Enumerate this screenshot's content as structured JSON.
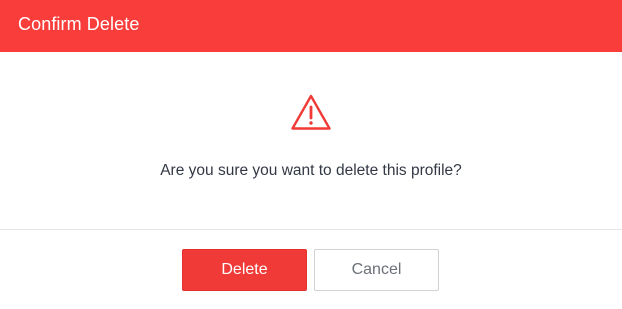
{
  "dialog": {
    "title": "Confirm Delete",
    "icon": "warning-triangle-icon",
    "message": "Are you sure you want to delete this profile?",
    "delete_label": "Delete",
    "cancel_label": "Cancel"
  },
  "colors": {
    "header_background": "#f93d3a",
    "danger_button": "#f03a37",
    "icon_stroke": "#f03a37",
    "message_text": "#333845",
    "cancel_text": "#6b6f78"
  }
}
